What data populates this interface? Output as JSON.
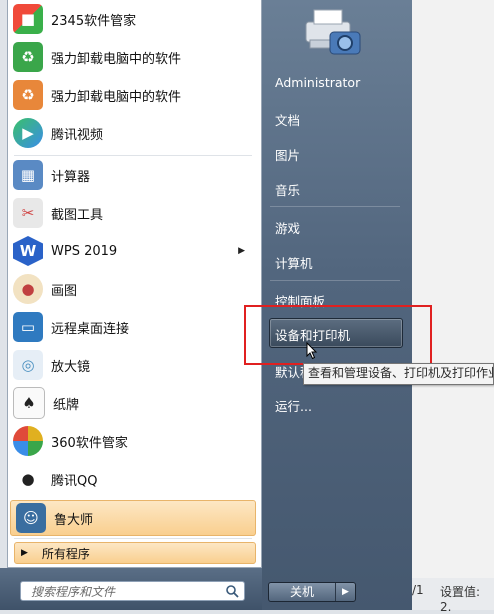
{
  "colors": {
    "highlight": "#f9cf8f",
    "red_box": "#e02020",
    "right_pane": "#52667e"
  },
  "programs": [
    {
      "label": "2345软件管家",
      "icon": "2345-manager-icon",
      "color": "#f06a3a"
    },
    {
      "label": "强力卸载电脑中的软件",
      "icon": "uninstall-green-icon",
      "color": "#3aa64a"
    },
    {
      "label": "强力卸载电脑中的软件",
      "icon": "uninstall-orange-icon",
      "color": "#e8873a"
    },
    {
      "label": "腾讯视频",
      "icon": "tencent-video-icon",
      "color": "#3a8de8"
    },
    {
      "label": "计算器",
      "icon": "calculator-icon",
      "color": "#5a8ac4"
    },
    {
      "label": "截图工具",
      "icon": "snipping-tool-icon",
      "color": "#d04444"
    },
    {
      "label": "WPS 2019",
      "icon": "wps-icon",
      "color": "#2a62c8",
      "arrow": "▶"
    },
    {
      "label": "画图",
      "icon": "paint-icon",
      "color": "#c98a3a"
    },
    {
      "label": "远程桌面连接",
      "icon": "remote-desktop-icon",
      "color": "#2f7ac0"
    },
    {
      "label": "放大镜",
      "icon": "magnifier-icon",
      "color": "#4a90c0"
    },
    {
      "label": "纸牌",
      "icon": "solitaire-icon",
      "color": "#8a8a8a"
    },
    {
      "label": "360软件管家",
      "icon": "360-manager-icon",
      "color": "#e0b020"
    },
    {
      "label": "腾讯QQ",
      "icon": "qq-icon",
      "color": "#222222"
    },
    {
      "label": "鲁大师",
      "icon": "ludashi-icon",
      "color": "#3a6ea0"
    }
  ],
  "all_programs": {
    "arrow": "▶",
    "label": "所有程序"
  },
  "search": {
    "placeholder": "搜索程序和文件"
  },
  "right_menu": {
    "user": "Administrator",
    "documents": "文档",
    "pictures": "图片",
    "music": "音乐",
    "games": "游戏",
    "computer": "计算机",
    "control_panel": "控制面板",
    "devices_printers": "设备和打印机",
    "default_programs": "默认程序",
    "run": "运行..."
  },
  "tooltip": "查看和管理设备、打印机及打印作业",
  "shutdown": {
    "label": "关机",
    "arrow": "▶"
  },
  "status": {
    "page": "/1",
    "settings": "设置值: 2."
  }
}
